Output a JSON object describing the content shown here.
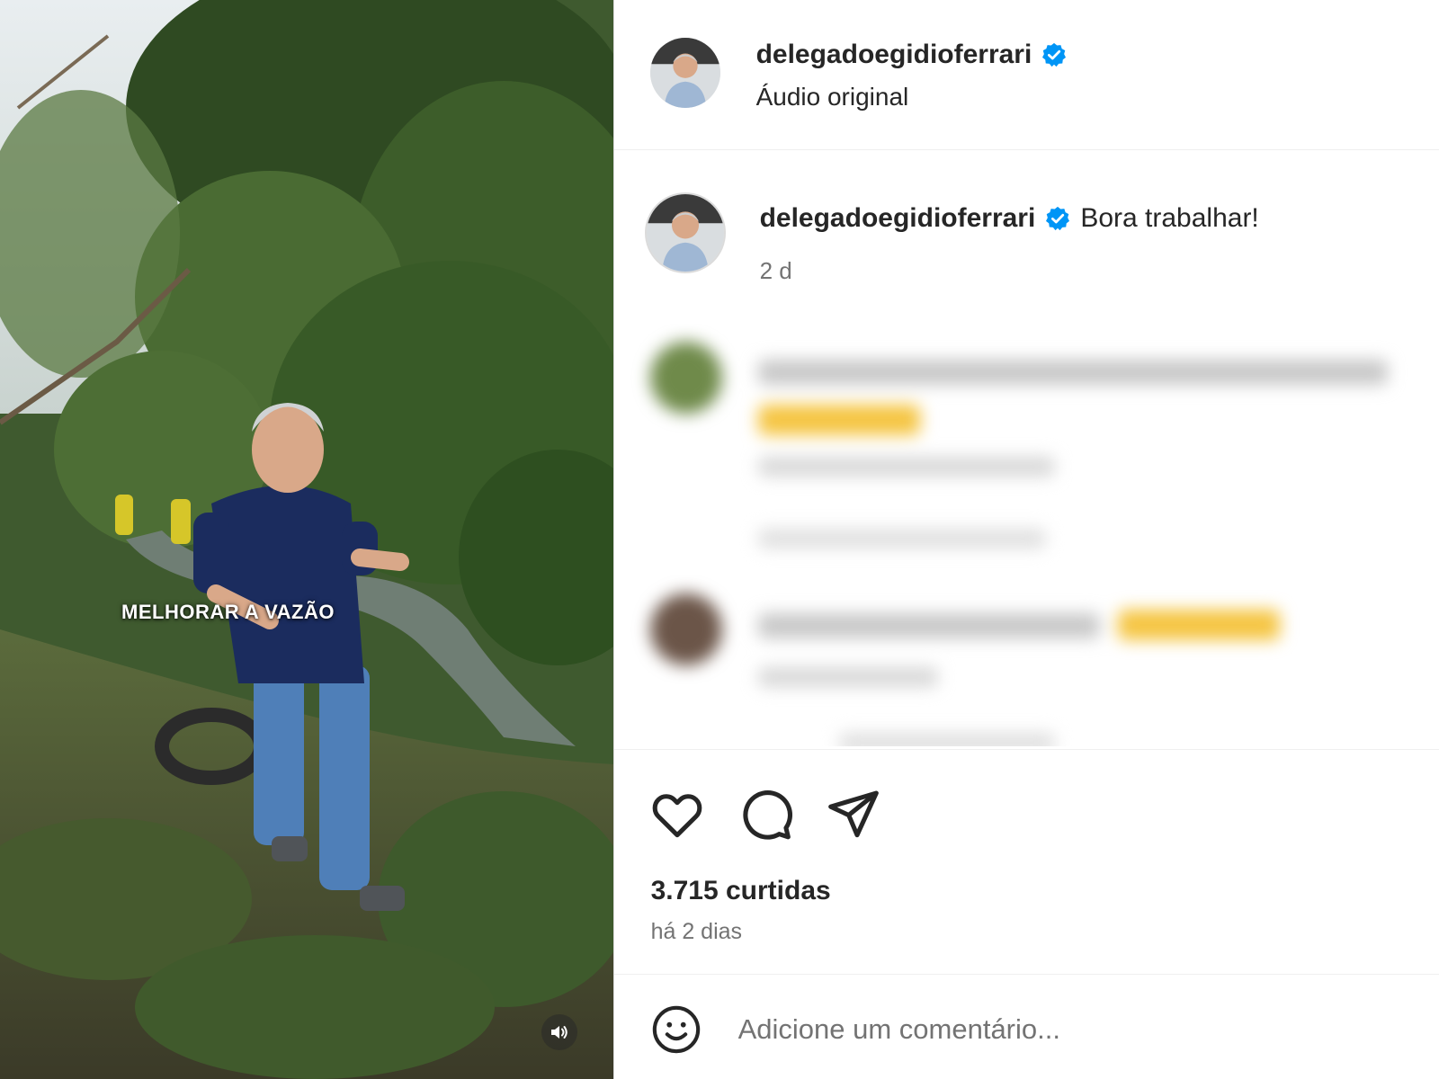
{
  "video": {
    "overlay_caption": "MELHORAR A VAZÃO",
    "mute_icon": "speaker-icon"
  },
  "post": {
    "username": "delegadoegidioferrari",
    "audio_label": "Áudio original",
    "verified": true,
    "verified_color": "#0095f6"
  },
  "caption": {
    "username": "delegadoegidioferrari",
    "text": "Bora trabalhar!",
    "time": "2 d"
  },
  "actions": {
    "icons": [
      "heart-icon",
      "comment-icon",
      "share-icon"
    ],
    "likes": "3.715 curtidas",
    "posted": "há 2 dias"
  },
  "comment_box": {
    "placeholder": "Adicione um comentário...",
    "emoji_icon": "smiley-icon"
  }
}
